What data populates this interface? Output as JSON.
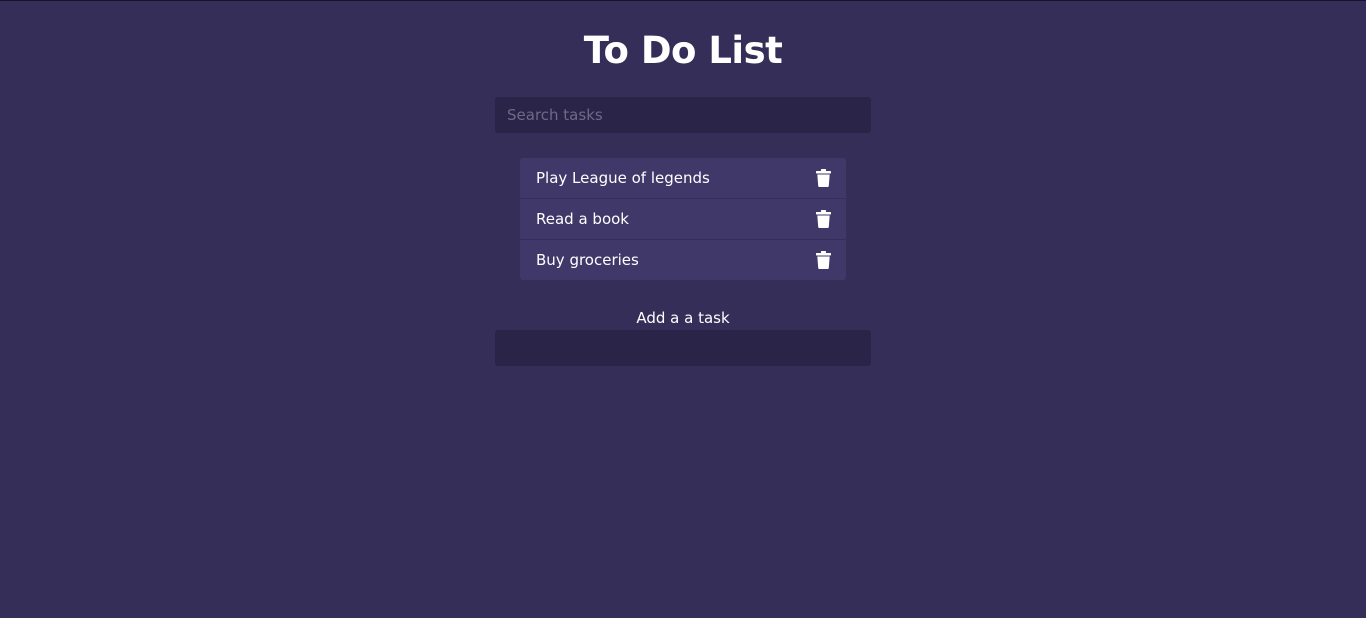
{
  "app": {
    "title": "To Do List"
  },
  "search": {
    "placeholder": "Search tasks",
    "value": ""
  },
  "tasks": [
    {
      "label": "Play League of legends",
      "icon": "trash-icon"
    },
    {
      "label": "Read a book",
      "icon": "trash-icon"
    },
    {
      "label": "Buy groceries",
      "icon": "trash-icon"
    }
  ],
  "add_task": {
    "label": "Add a a task",
    "value": ""
  },
  "colors": {
    "background": "#352e58",
    "input_background": "#2a2449",
    "task_background": "#41386a",
    "text": "#ffffff",
    "placeholder": "#6f6a87"
  }
}
